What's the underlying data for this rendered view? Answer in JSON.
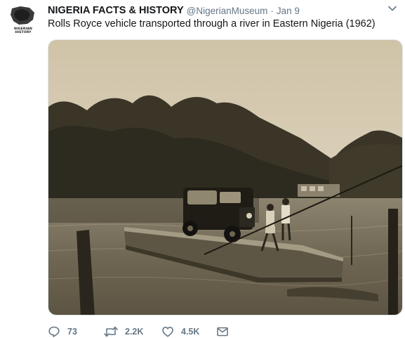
{
  "tweet": {
    "author": {
      "name": "NIGERIA FACTS & HISTORY",
      "handle": "@NigerianMuseum",
      "avatar_text": "NIGERIAN HISTORY"
    },
    "separator": "·",
    "date": "Jan 9",
    "text": "Rolls Royce vehicle transported through a river in Eastern Nigeria (1962)",
    "media": {
      "type": "photo",
      "subject": "vintage car on a ferry raft crossing a river"
    },
    "actions": {
      "reply": {
        "icon": "reply-icon",
        "count": "73"
      },
      "retweet": {
        "icon": "retweet-icon",
        "count": "2.2K"
      },
      "like": {
        "icon": "heart-icon",
        "count": "4.5K"
      },
      "message": {
        "icon": "direct-message-icon"
      }
    }
  },
  "colors": {
    "text_primary": "#14171a",
    "text_secondary": "#657786",
    "border": "#e1e8ed"
  }
}
